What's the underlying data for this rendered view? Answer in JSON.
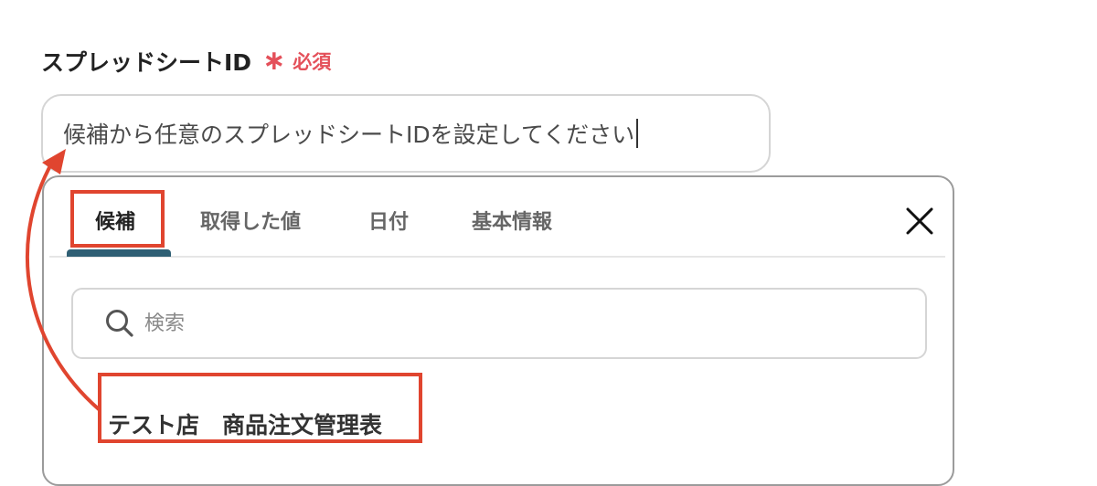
{
  "field": {
    "label": "スプレッドシートID",
    "required_star": "∗",
    "required_text": "必須",
    "input_value": "候補から任意のスプレッドシートIDを設定してください"
  },
  "panel": {
    "tabs": [
      {
        "label": "候補",
        "active": true
      },
      {
        "label": "取得した値",
        "active": false
      },
      {
        "label": "日付",
        "active": false
      },
      {
        "label": "基本情報",
        "active": false
      }
    ],
    "close_icon": "close-icon",
    "search": {
      "placeholder": "検索",
      "icon": "search-icon"
    },
    "candidates": [
      {
        "label": "テスト店　商品注文管理表"
      }
    ]
  },
  "colors": {
    "accent": "#2f5f74",
    "required": "#e4505a",
    "annotation": "#e0452f"
  }
}
